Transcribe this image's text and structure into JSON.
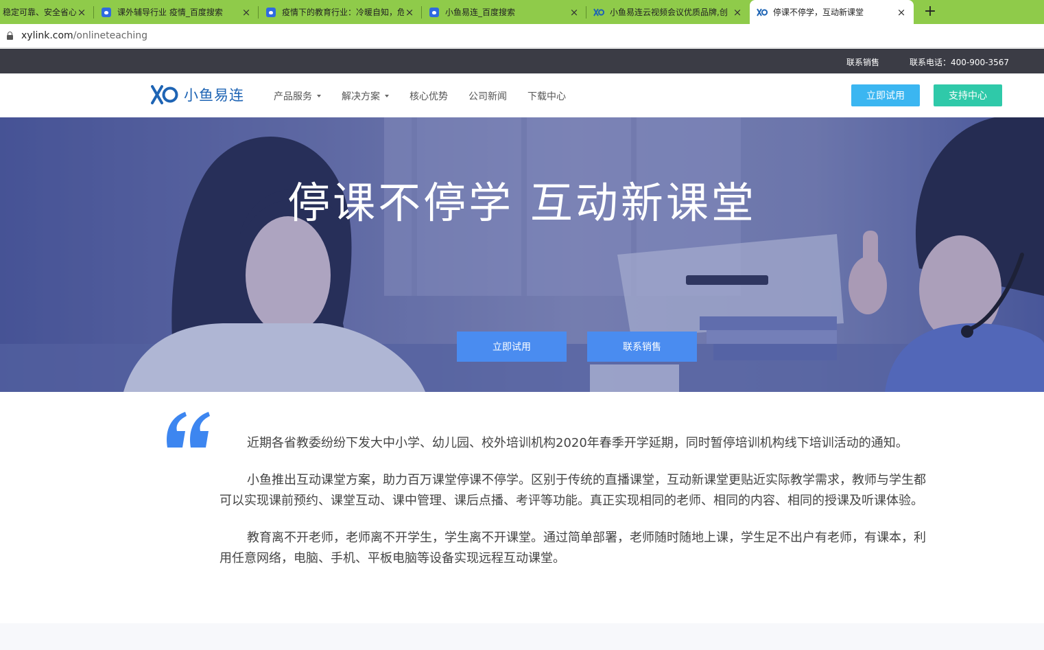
{
  "browser": {
    "tabs": [
      {
        "title": "稳定可靠、安全省心",
        "icon": "generic-favicon",
        "active": false
      },
      {
        "title": "课外辅导行业 疫情_百度搜索",
        "icon": "baidu-icon",
        "active": false
      },
      {
        "title": "疫情下的教育行业：冷暖自知，危",
        "icon": "baidu-icon",
        "active": false
      },
      {
        "title": "小鱼易连_百度搜索",
        "icon": "baidu-icon",
        "active": false
      },
      {
        "title": "小鱼易连云视频会议优质品牌,创",
        "icon": "xylink-icon",
        "active": false
      },
      {
        "title": "停课不停学，互动新课堂",
        "icon": "xylink-icon",
        "active": true
      }
    ],
    "new_tab_label": "+",
    "close_label": "×",
    "url_host": "xylink.com",
    "url_path": "/onlineteaching"
  },
  "topbar": {
    "contact_sales": "联系销售",
    "phone": "联系电话：400-900-3567"
  },
  "nav": {
    "logo_text": "小鱼易连",
    "menu": [
      {
        "label": "产品服务",
        "dropdown": true
      },
      {
        "label": "解决方案",
        "dropdown": true
      },
      {
        "label": "核心优势",
        "dropdown": false
      },
      {
        "label": "公司新闻",
        "dropdown": false
      },
      {
        "label": "下载中心",
        "dropdown": false
      }
    ],
    "trial_button": "立即试用",
    "support_button": "支持中心"
  },
  "hero": {
    "title": "停课不停学  互动新课堂",
    "trial_button": "立即试用",
    "contact_button": "联系销售"
  },
  "content": {
    "paragraphs": [
      "近期各省教委纷纷下发大中小学、幼儿园、校外培训机构2020年春季开学延期，同时暂停培训机构线下培训活动的通知。",
      "小鱼推出互动课堂方案，助力百万课堂停课不停学。区别于传统的直播课堂，互动新课堂更贴近实际教学需求，教师与学生都可以实现课前预约、课堂互动、课中管理、课后点播、考评等功能。真正实现相同的老师、相同的内容、相同的授课及听课体验。",
      "教育离不开老师，老师离不开学生，学生离不开课堂。通过简单部署，老师随时随地上课，学生足不出户有老师，有课本，利用任意网络，电脑、手机、平板电脑等设备实现远程互动课堂。"
    ]
  },
  "colors": {
    "tab_bar": "#8fcb4a",
    "top_bar": "#3b3c45",
    "brand_blue": "#1e64b4",
    "trial_button": "#3bb6f1",
    "support_button": "#2fc9a9",
    "hero_button": "#4a8cf0",
    "quote_mark": "#3d86f0"
  }
}
